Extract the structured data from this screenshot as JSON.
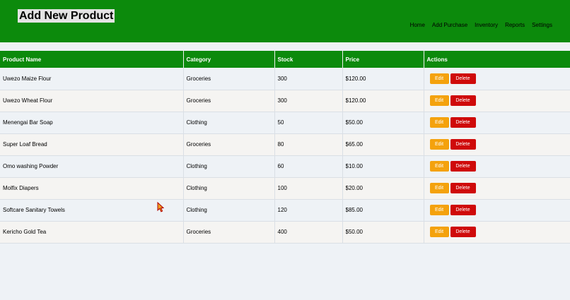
{
  "header": {
    "title": "Add New Product",
    "nav": [
      "Home",
      "Add Purchase",
      "Inventory",
      "Reports",
      "Settings"
    ]
  },
  "table": {
    "columns": [
      "Product Name",
      "Category",
      "Stock",
      "Price",
      "Actions"
    ],
    "edit_label": "Edit",
    "delete_label": "Delete",
    "rows": [
      {
        "name": "Uwezo Maize Flour",
        "category": "Groceries",
        "stock": "300",
        "price": "$120.00"
      },
      {
        "name": "Uwezo Wheat Flour",
        "category": "Groceries",
        "stock": "300",
        "price": "$120.00"
      },
      {
        "name": "Menengai Bar Soap",
        "category": "Clothing",
        "stock": "50",
        "price": "$50.00"
      },
      {
        "name": "Super Loaf Bread",
        "category": "Groceries",
        "stock": "80",
        "price": "$65.00"
      },
      {
        "name": "Omo washing Powder",
        "category": "Clothing",
        "stock": "60",
        "price": "$10.00"
      },
      {
        "name": "Molfix Diapers",
        "category": "Clothing",
        "stock": "100",
        "price": "$20.00"
      },
      {
        "name": "Softcare Sanitary Towels",
        "category": "Clothing",
        "stock": "120",
        "price": "$85.00"
      },
      {
        "name": "Kericho Gold Tea",
        "category": "Groceries",
        "stock": "400",
        "price": "$50.00"
      }
    ]
  },
  "colors": {
    "header_bg": "#0c8a0c",
    "edit": "#f4a20d",
    "delete": "#cf0a0a"
  },
  "icons": {
    "cursor": "mouse-pointer-icon"
  }
}
